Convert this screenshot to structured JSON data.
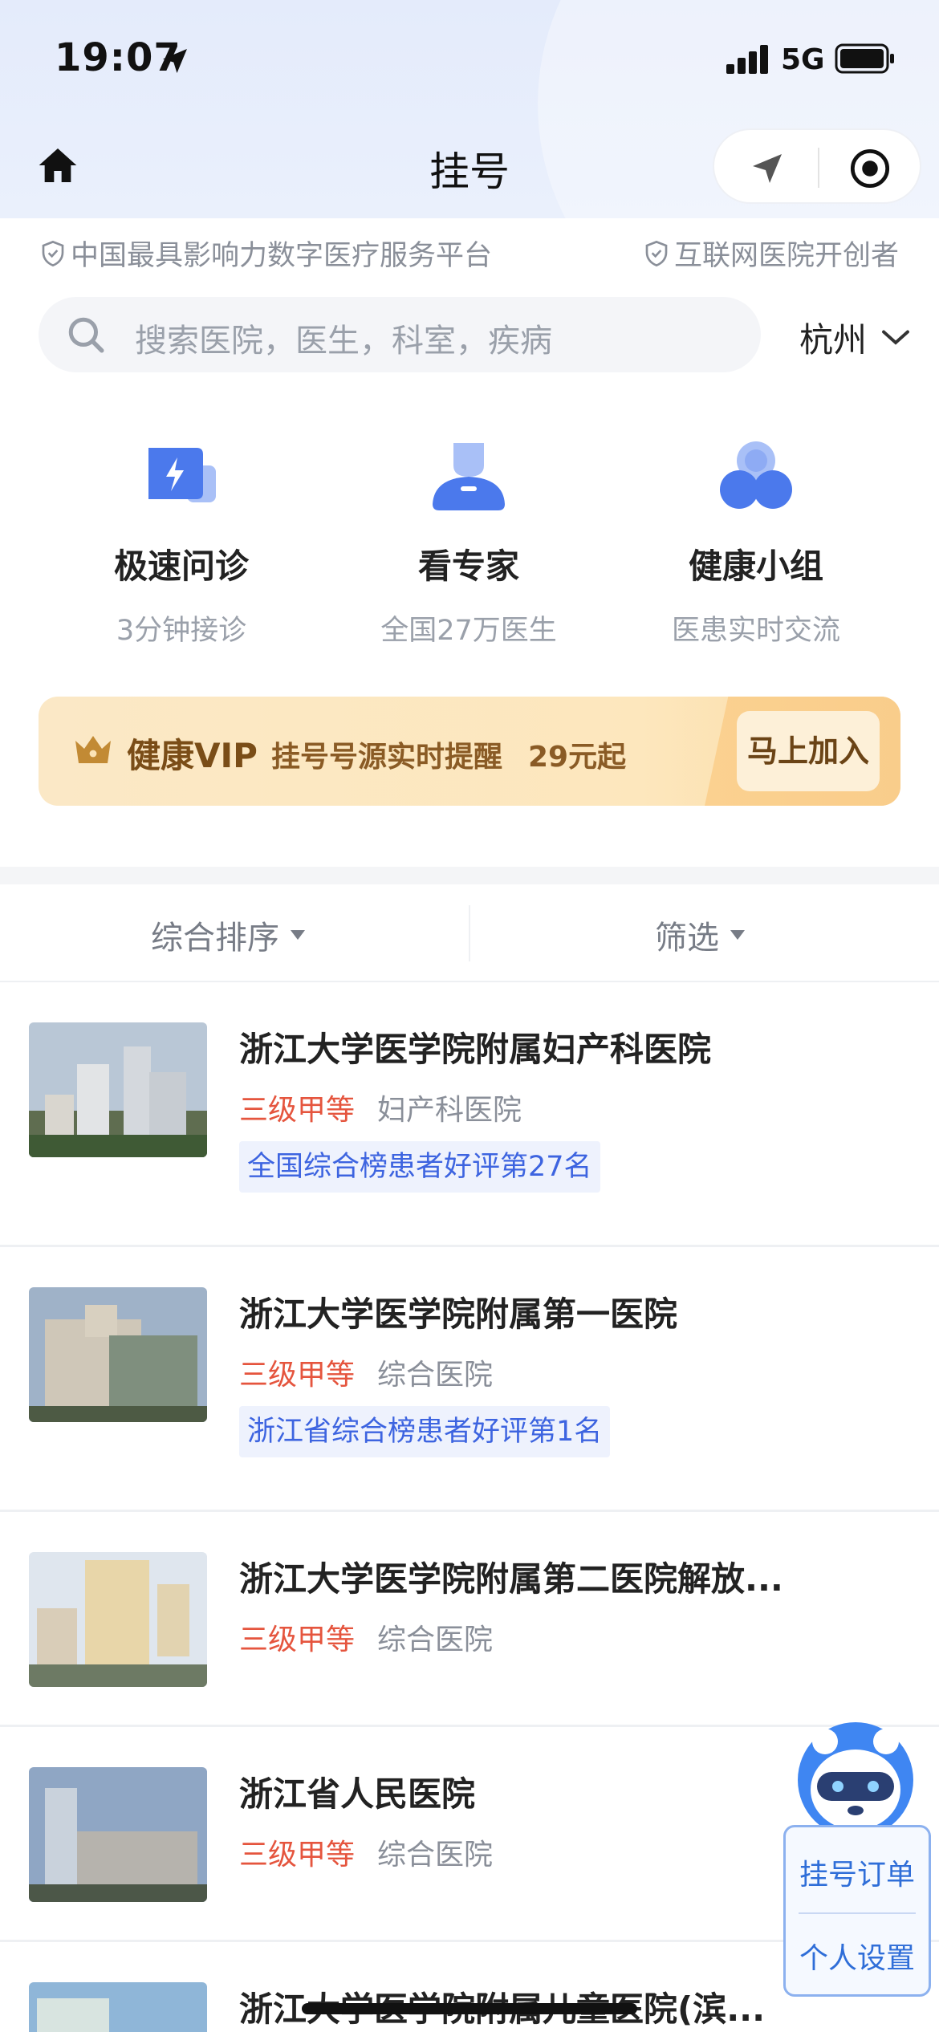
{
  "status_bar": {
    "time": "19:07",
    "network": "5G"
  },
  "nav": {
    "title": "挂号"
  },
  "slogans": {
    "left": "中国最具影响力数字医疗服务平台",
    "right": "互联网医院开创者"
  },
  "search": {
    "placeholder": "搜索医院，医生，科室，疾病",
    "city": "杭州"
  },
  "quick_actions": [
    {
      "title": "极速问诊",
      "subtitle": "3分钟接诊",
      "icon": "lightning-chat-icon"
    },
    {
      "title": "看专家",
      "subtitle": "全国27万医生",
      "icon": "doctor-icon"
    },
    {
      "title": "健康小组",
      "subtitle": "医患实时交流",
      "icon": "group-icon"
    }
  ],
  "vip": {
    "title": "健康VIP",
    "desc": "挂号号源实时提醒",
    "price": "29元起",
    "button": "马上加入"
  },
  "sort": {
    "left": "综合排序",
    "right": "筛选"
  },
  "hospitals": [
    {
      "name": "浙江大学医学院附属妇产科医院",
      "grade": "三级甲等",
      "type": "妇产科医院",
      "tag": "全国综合榜患者好评第27名"
    },
    {
      "name": "浙江大学医学院附属第一医院",
      "grade": "三级甲等",
      "type": "综合医院",
      "tag": "浙江省综合榜患者好评第1名"
    },
    {
      "name": "浙江大学医学院附属第二医院解放...",
      "grade": "三级甲等",
      "type": "综合医院",
      "tag": ""
    },
    {
      "name": "浙江省人民医院",
      "grade": "三级甲等",
      "type": "综合医院",
      "tag": ""
    },
    {
      "name": "浙江大学医学院附属儿童医院(滨...",
      "grade": "",
      "type": "",
      "tag": ""
    }
  ],
  "float_menu": {
    "orders": "挂号订单",
    "settings": "个人设置"
  },
  "colors": {
    "accent_blue": "#3d64e0",
    "grade_red": "#e5553e",
    "vip_gold": "#fbe3b6"
  }
}
